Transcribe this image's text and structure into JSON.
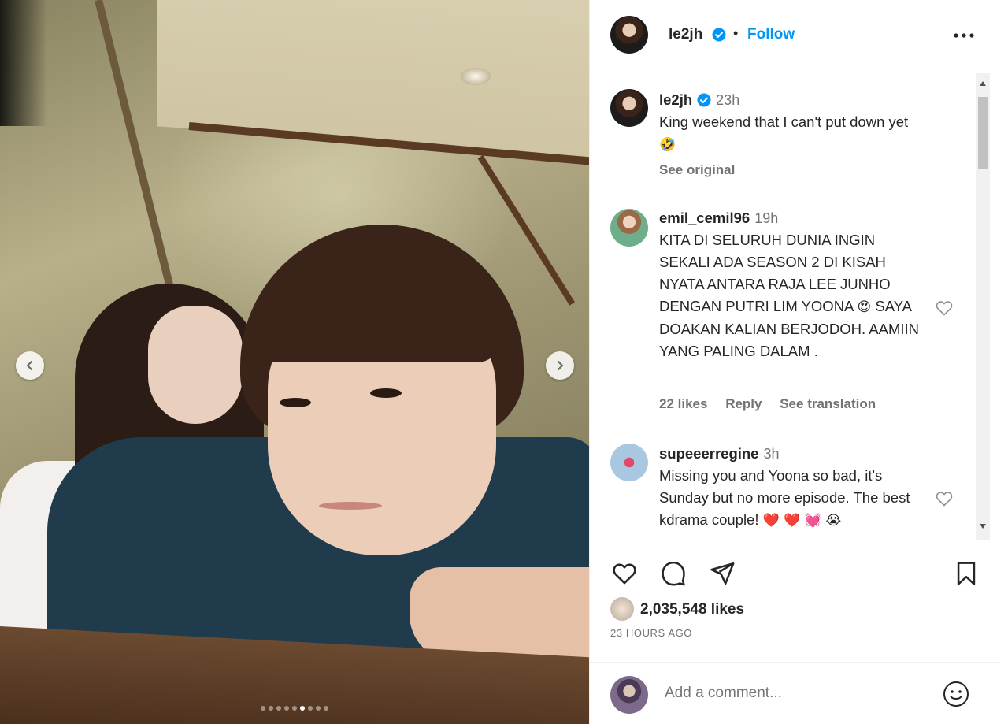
{
  "post": {
    "username": "le2jh",
    "follow_label": "Follow",
    "separator": "•"
  },
  "comments": [
    {
      "username": "le2jh",
      "time": "23h",
      "text": "King weekend that I can't put down yet",
      "emoji": "🤣",
      "see_original": "See original"
    },
    {
      "username": "emil_cemil96",
      "time": "19h",
      "text": "KITA DI SELURUH DUNIA INGIN SEKALI ADA SEASON 2 DI KISAH NYATA ANTARA RAJA LEE JUNHO DENGAN PUTRI LIM YOONA",
      "emoji": "😍",
      "text2": "SAYA DOAKAN KALIAN BERJODOH. AAMIIN YANG PALING DALAM .",
      "likes": "22 likes",
      "reply": "Reply",
      "see_translation": "See translation"
    },
    {
      "username": "supeeerregine",
      "time": "3h",
      "text": "Missing you and Yoona so bad, it's Sunday but no more episode. The best kdrama couple!",
      "emojis": "❤️ ❤️ 💓 😭"
    }
  ],
  "likes_count": "2,035,548 likes",
  "post_time": "23 HOURS AGO",
  "add_comment": {
    "placeholder": "Add a comment..."
  },
  "carousel": {
    "total": 9,
    "active_index": 5
  },
  "colors": {
    "accent": "#0095f6",
    "text": "#262626",
    "muted": "#737373"
  }
}
